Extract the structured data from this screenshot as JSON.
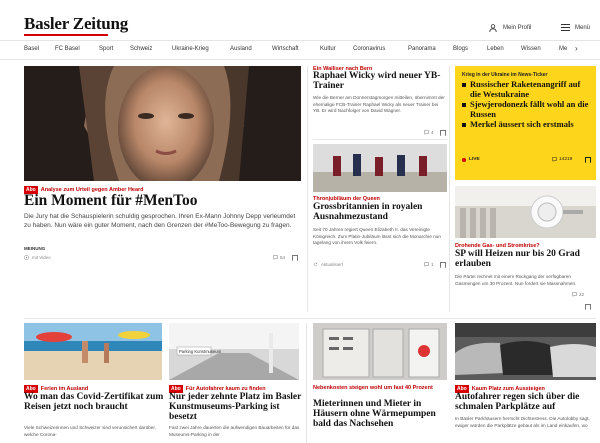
{
  "header": {
    "logo": "Basler Zeitung",
    "profile_label": "Mein Profil",
    "menu_label": "Menü"
  },
  "nav": [
    "Basel",
    "FC Basel",
    "Sport",
    "Schweiz",
    "Ukraine-Krieg",
    "Ausland",
    "Wirtschaft",
    "Kultur",
    "Coronavirus",
    "Panorama",
    "Blogs",
    "Leben",
    "Wissen",
    "Me"
  ],
  "hero": {
    "tag": "Abo",
    "kicker": "Analyse zum Urteil gegen Amber Heard",
    "title": "Ein Moment für #MenToo",
    "teaser": "Die Jury hat die Schauspielerin schuldig gesprochen. Ihren Ex-Mann Johnny Depp verleumdet zu haben. Nun wäre ein guter Moment, nach den Grenzen der #MeToo-Bewegung zu fragen.",
    "label": "MEINUNG",
    "meta": "mit Video",
    "comments": "54"
  },
  "wicky": {
    "kicker": "Ein Walliser nach Bern",
    "title": "Raphael Wicky wird neuer YB-Trainer",
    "teaser": "Wie die Berner am Donnerstagmorgen mitteilen, übernimmt der ehemalige FCB-Trainer Raphael Wicky als neuer Trainer bei YB. Er wird Nachfolger von David Wagner.",
    "comments": "4"
  },
  "queen": {
    "kicker": "Thronjubiläum der Queen",
    "title": "Grossbritannien in royalen Ausnahmezustand",
    "teaser": "Seit 70 Jahren regiert Queen Elizabeth II. das Vereinigte Königreich. Zum Platin-Jubiläum lässt sich die Monarchie nun tagelang von ihrem Volk feiern.",
    "meta": "Aktualisiert",
    "comments": "1"
  },
  "ticker": {
    "kicker": "Krieg in der Ukraine im News-Ticker",
    "items": [
      "Russischer Raketenangriff auf die Westukraine",
      "Sjewjerodonezk fällt wohl an die Russen",
      "Merkel äussert sich erstmals"
    ],
    "live": "LIVE",
    "count": "14219"
  },
  "gas": {
    "kicker": "Drohende Gas- und Stromkrise?",
    "title": "SP will Heizen nur bis 20 Grad erlauben",
    "teaser": "Die Partei rechnet mit einem Rückgang der verfügbaren Gasmengen um 30 Prozent. Nun fordert sie Massnahmen.",
    "comments": "22"
  },
  "covid": {
    "tag": "Abo",
    "kicker": "Ferien im Ausland",
    "title": "Wo man das Covid-Zertifikat zum Reisen jetzt noch braucht",
    "teaser": "Viele Schweizerinnen und Schweizer sind verunsichert darüber, welche Corona-"
  },
  "parking": {
    "tag": "Abo",
    "kicker": "Für Autofahrer kaum zu finden",
    "title": "Nur jeder zehnte Platz im Basler Kunstmuseums-Parking ist besetzt",
    "teaser": "Fast zwei Jahre dauerten die aufwendigen Bauarbeiten für das Museums-Parking in der",
    "sign": "Parking Kunstmuseum"
  },
  "heating": {
    "kicker": "Nebenkosten steigen wohl um fast 40 Prozent",
    "title": "Mieterinnen und Mieter in Häusern ohne Wärmepumpen bald das Nachsehen"
  },
  "cars": {
    "tag": "Abo",
    "kicker": "Kaum Platz zum Aussteigen",
    "title": "Autofahrer regen sich über die schmalen Parkplätze auf",
    "teaser": "In Basler Parkhäusern herrscht Dichtestress. Die Autolobby sagt, ewiger würden die Parkplätze gebaut als im Land einkaufen, wo"
  }
}
